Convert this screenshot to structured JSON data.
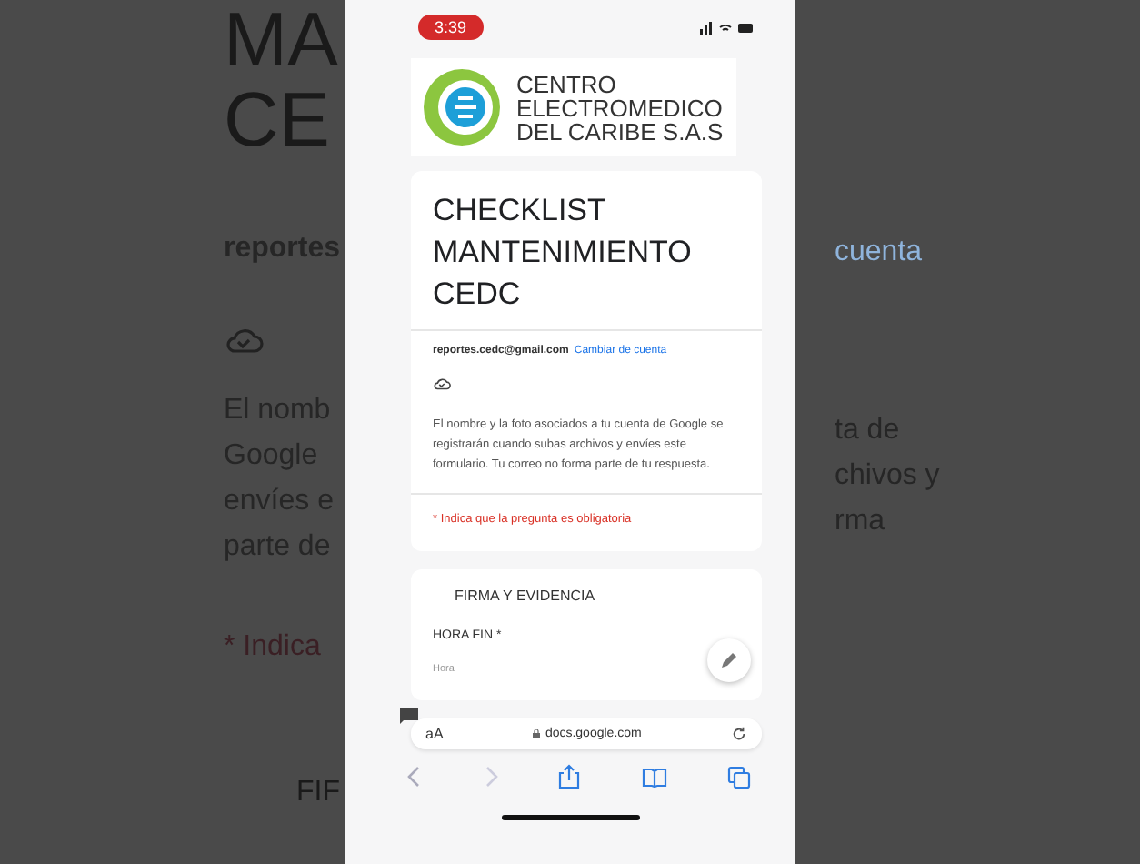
{
  "backdrop": {
    "left": {
      "title_lines": [
        "MA",
        "CE"
      ],
      "email": "reportes",
      "notice_lines": [
        "El nomb",
        "Google",
        "envíes e",
        "parte de"
      ],
      "required_note": "* Indica",
      "section": "FIF"
    },
    "right": {
      "link": "cuenta",
      "notice_lines": [
        "ta de",
        "chivos y",
        "rma"
      ]
    }
  },
  "status_bar": {
    "time": "3:39"
  },
  "banner": {
    "lines": [
      "CENTRO",
      "ELECTROMEDICO",
      "DEL CARIBE S.A.S"
    ]
  },
  "form": {
    "title": "CHECKLIST MANTENIMIENTO CEDC",
    "email": "reportes.cedc@gmail.com",
    "switch_account": "Cambiar de cuenta",
    "notice": "El nombre y la foto asociados a tu cuenta de Google se registrarán cuando subas archivos y envíes este formulario. Tu correo no forma parte de tu respuesta.",
    "required_note": "* Indica que la pregunta es obligatoria"
  },
  "section": {
    "title": "FIRMA Y EVIDENCIA",
    "question": "HORA FIN *",
    "placeholder": "Hora"
  },
  "browser": {
    "text_size": "aA",
    "url": "docs.google.com"
  }
}
